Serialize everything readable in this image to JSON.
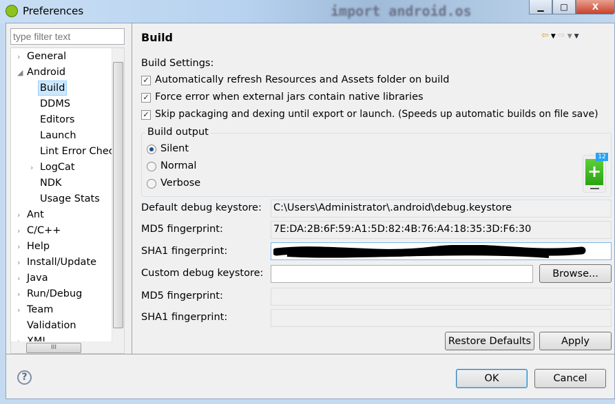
{
  "window": {
    "title": "Preferences",
    "background_code": "import android.os"
  },
  "filter": {
    "placeholder": "type filter text"
  },
  "tree": [
    {
      "label": "General",
      "expandable": true,
      "expanded": false,
      "level": 0
    },
    {
      "label": "Android",
      "expandable": true,
      "expanded": true,
      "level": 0
    },
    {
      "label": "Build",
      "level": 1,
      "selected": true
    },
    {
      "label": "DDMS",
      "level": 1
    },
    {
      "label": "Editors",
      "level": 1
    },
    {
      "label": "Launch",
      "level": 1
    },
    {
      "label": "Lint Error Checking",
      "level": 1
    },
    {
      "label": "LogCat",
      "level": 1,
      "expandable": true
    },
    {
      "label": "NDK",
      "level": 1
    },
    {
      "label": "Usage Stats",
      "level": 1
    },
    {
      "label": "Ant",
      "expandable": true,
      "level": 0
    },
    {
      "label": "C/C++",
      "expandable": true,
      "level": 0
    },
    {
      "label": "Help",
      "expandable": true,
      "level": 0
    },
    {
      "label": "Install/Update",
      "expandable": true,
      "level": 0
    },
    {
      "label": "Java",
      "expandable": true,
      "level": 0
    },
    {
      "label": "Run/Debug",
      "expandable": true,
      "level": 0
    },
    {
      "label": "Team",
      "expandable": true,
      "level": 0
    },
    {
      "label": "Validation",
      "level": 0
    },
    {
      "label": "XML",
      "expandable": true,
      "level": 0
    }
  ],
  "page": {
    "title": "Build",
    "settings_label": "Build Settings:",
    "checkboxes": [
      {
        "label": "Automatically refresh Resources and Assets folder on build",
        "checked": true
      },
      {
        "label": "Force error when external jars contain native libraries",
        "checked": true
      },
      {
        "label": "Skip packaging and dexing until export or launch. (Speeds up automatic builds on file save)",
        "checked": true
      }
    ],
    "build_output": {
      "label": "Build output",
      "options": [
        "Silent",
        "Normal",
        "Verbose"
      ],
      "selected": "Silent"
    },
    "fields": {
      "default_keystore_label": "Default debug keystore:",
      "default_keystore": "C:\\Users\\Administrator\\.android\\debug.keystore",
      "md5_label": "MD5 fingerprint:",
      "md5": "7E:DA:2B:6F:59:A1:5D:82:4B:76:A4:18:35:3D:F6:30",
      "sha1_label": "SHA1 fingerprint:",
      "custom_keystore_label": "Custom debug keystore:",
      "custom_keystore": "",
      "browse": "Browse...",
      "md5_custom_label": "MD5 fingerprint:",
      "sha1_custom_label": "SHA1 fingerprint:"
    },
    "restore_defaults": "Restore Defaults",
    "apply": "Apply"
  },
  "buttons": {
    "ok": "OK",
    "cancel": "Cancel",
    "help": "?"
  },
  "widget": {
    "badge": "12",
    "icon": "plus-icon"
  },
  "colors": {
    "selection": "#cce8ff",
    "widget_green": "#3cb521",
    "badge_blue": "#29a3f2"
  }
}
